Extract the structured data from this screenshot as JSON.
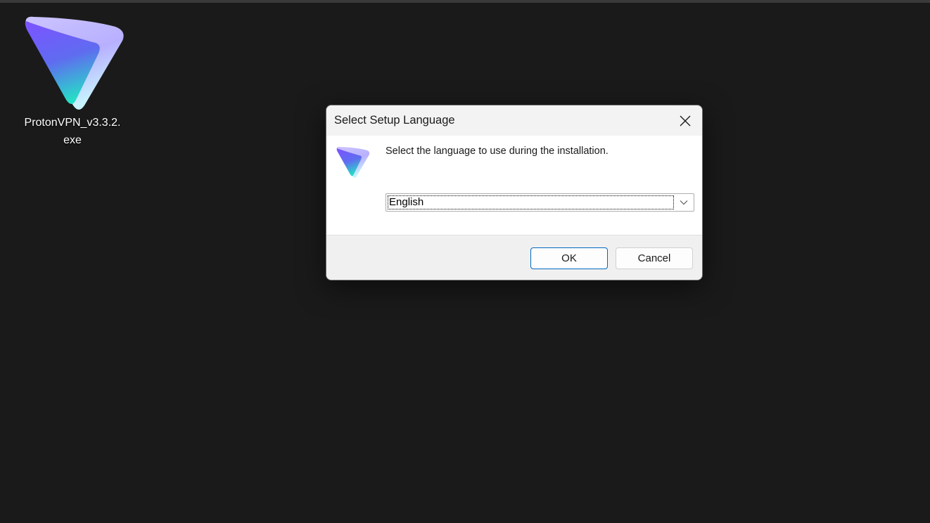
{
  "desktop": {
    "icon": {
      "name": "protonvpn-installer-icon",
      "label": "ProtonVPN_v3.3.2.exe"
    }
  },
  "dialog": {
    "title": "Select Setup Language",
    "prompt": "Select the language to use during the installation.",
    "language_select": {
      "value": "English"
    },
    "buttons": {
      "ok": "OK",
      "cancel": "Cancel"
    }
  },
  "colors": {
    "desktop_bg": "#1a1a1a",
    "accent": "#0067c0",
    "logo_gradient_top": "#6d4aff",
    "logo_gradient_bottom": "#2de2c8"
  }
}
